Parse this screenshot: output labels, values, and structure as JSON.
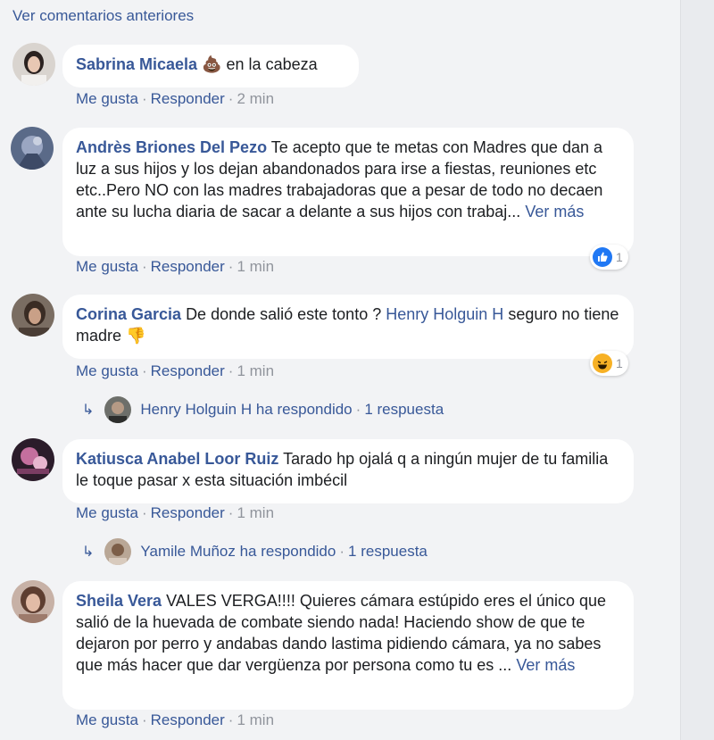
{
  "prev_comments_link": "Ver comentarios anteriores",
  "actions": {
    "like": "Me gusta",
    "reply": "Responder",
    "separator": "·"
  },
  "comments": [
    {
      "author": "Sabrina Micaela",
      "text": "en la cabeza",
      "emoji": "💩",
      "time": "2 min"
    },
    {
      "author": "Andrès Briones Del Pezo",
      "text": "Te acepto que te metas con Madres que dan a luz a sus hijos y los dejan abandonados para irse a fiestas, reuniones etc etc..Pero NO con las madres trabajadoras que a pesar de todo no decaen ante su lucha diaria de sacar a delante a sus hijos con trabaj...",
      "see_more": "Ver más",
      "time": "1 min",
      "reaction": {
        "icon": "like-icon",
        "count": "1",
        "color": "#2078f4"
      }
    },
    {
      "author": "Corina Garcia",
      "text_before": "De donde salió este tonto ?",
      "mention": "Henry Holguin H",
      "text_after": "seguro no tiene madre",
      "emoji": "👎",
      "time": "1 min",
      "reaction": {
        "icon": "haha-icon",
        "count": "1",
        "color": "#f7b125"
      },
      "replies": {
        "name": "Henry Holguin H",
        "label": "ha respondido",
        "count": "1 respuesta"
      }
    },
    {
      "author": "Katiusca Anabel Loor Ruiz",
      "text": "Tarado hp ojalá q a ningún mujer de tu familia le toque pasar x esta situación imbécil",
      "time": "1 min",
      "replies": {
        "name": "Yamile Muñoz",
        "label": "ha respondido",
        "count": "1 respuesta"
      }
    },
    {
      "author": "Sheila Vera",
      "text": "VALES VERGA!!!! Quieres cámara estúpido eres el único que salió de la huevada de combate siendo nada! Haciendo show de que te dejaron por perro y andabas dando lastima pidiendo cámara, ya no sabes que más hacer que dar vergüenza por persona como tu es ...",
      "see_more": "Ver más",
      "time": "1 min"
    }
  ]
}
